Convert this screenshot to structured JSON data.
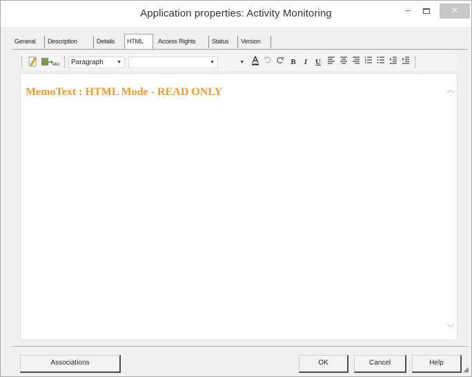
{
  "window": {
    "title": "Application properties: Activity Monitoring",
    "minimize_glyph": "–",
    "close_glyph": "✕"
  },
  "tabs": [
    {
      "label": "General",
      "active": false
    },
    {
      "label": "Description",
      "active": false
    },
    {
      "label": "Details",
      "active": false
    },
    {
      "label": "HTML",
      "active": true
    },
    {
      "label": "Access Rights",
      "active": false
    },
    {
      "label": "Status",
      "active": false
    },
    {
      "label": "Version",
      "active": false
    }
  ],
  "toolbar": {
    "format_select_value": "Paragraph",
    "font_select_value": "",
    "size_select_value": "",
    "bold_glyph": "B",
    "italic_glyph": "I",
    "underline_glyph": "U",
    "icons": [
      "edit-icon",
      "spellcheck-icon",
      "font-color-icon",
      "undo-icon",
      "redo-icon",
      "bold-icon",
      "italic-icon",
      "underline-icon",
      "align-left-icon",
      "align-center-icon",
      "align-right-icon",
      "ordered-list-icon",
      "unordered-list-icon",
      "outdent-icon",
      "indent-icon"
    ]
  },
  "editor": {
    "content": "MemoText : HTML Mode - READ ONLY",
    "content_color": "#f59a2a"
  },
  "buttons": {
    "associations": "Associations",
    "ok": "OK",
    "cancel": "Cancel",
    "help": "Help"
  }
}
